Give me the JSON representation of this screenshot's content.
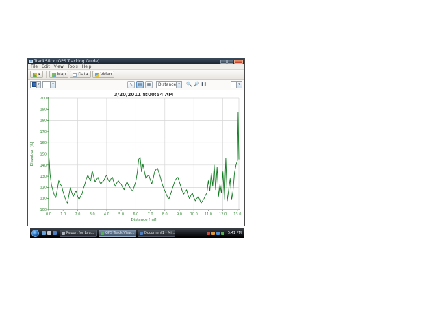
{
  "colors": {
    "line_green": "#0e7a1e",
    "spike_green": "#3f9e4f",
    "grid_gray": "#d6d6d6",
    "axis_green": "#2e7d32",
    "tick_text_green": "#3a8a3a",
    "title_text": "#333333"
  },
  "window": {
    "title": "TrackStick (GPS Tracking Guide)",
    "minimize_label": "minimize",
    "maximize_label": "maximize",
    "close_label": "close"
  },
  "menu": {
    "items": [
      "File",
      "Edit",
      "View",
      "Tools",
      "Help"
    ]
  },
  "toolbar": {
    "buttons": [
      {
        "label": "Map"
      },
      {
        "label": "Data"
      },
      {
        "label": "Video"
      }
    ]
  },
  "chart_toolbar": {
    "mode_dropdown_value": "Distance",
    "zoom_in_glyph": "🔍",
    "zoom_out_glyph": "🔎",
    "pause_glyph": "❚❚"
  },
  "chart_data": {
    "type": "line",
    "title": "3/20/2011 8:00:54 AM",
    "xlabel": "Distance [mi]",
    "ylabel": "Elevation [ft]",
    "xlim": [
      0,
      13.1
    ],
    "ylim": [
      100,
      200
    ],
    "xticks": [
      "0.0",
      "1.0",
      "2.0",
      "3.0",
      "4.0",
      "5.0",
      "6.0",
      "7.0",
      "8.0",
      "9.0",
      "10.0",
      "11.0",
      "12.0",
      "13.0"
    ],
    "yticks": [
      100,
      110,
      120,
      130,
      140,
      150,
      160,
      170,
      180,
      190,
      200
    ],
    "grid": true,
    "series": [
      {
        "name": "Elevation",
        "points": [
          [
            0.0,
            151
          ],
          [
            0.05,
            143
          ],
          [
            0.1,
            132
          ],
          [
            0.2,
            122
          ],
          [
            0.3,
            117
          ],
          [
            0.4,
            113
          ],
          [
            0.5,
            111
          ],
          [
            0.6,
            118
          ],
          [
            0.7,
            126
          ],
          [
            0.8,
            123
          ],
          [
            0.9,
            121
          ],
          [
            1.0,
            116
          ],
          [
            1.1,
            112
          ],
          [
            1.2,
            108
          ],
          [
            1.3,
            106
          ],
          [
            1.4,
            113
          ],
          [
            1.5,
            120
          ],
          [
            1.6,
            115
          ],
          [
            1.7,
            112
          ],
          [
            1.8,
            115
          ],
          [
            1.9,
            117
          ],
          [
            2.0,
            112
          ],
          [
            2.1,
            109
          ],
          [
            2.2,
            112
          ],
          [
            2.3,
            114
          ],
          [
            2.4,
            119
          ],
          [
            2.5,
            123
          ],
          [
            2.6,
            128
          ],
          [
            2.7,
            131
          ],
          [
            2.8,
            128
          ],
          [
            2.9,
            126
          ],
          [
            3.0,
            135
          ],
          [
            3.1,
            130
          ],
          [
            3.2,
            125
          ],
          [
            3.3,
            127
          ],
          [
            3.4,
            129
          ],
          [
            3.5,
            125
          ],
          [
            3.6,
            123
          ],
          [
            3.7,
            125
          ],
          [
            3.8,
            126
          ],
          [
            3.9,
            129
          ],
          [
            4.0,
            131
          ],
          [
            4.1,
            127
          ],
          [
            4.2,
            125
          ],
          [
            4.3,
            128
          ],
          [
            4.4,
            129
          ],
          [
            4.5,
            124
          ],
          [
            4.6,
            121
          ],
          [
            4.7,
            124
          ],
          [
            4.8,
            126
          ],
          [
            4.9,
            124
          ],
          [
            5.0,
            123
          ],
          [
            5.1,
            120
          ],
          [
            5.2,
            118
          ],
          [
            5.3,
            122
          ],
          [
            5.4,
            125
          ],
          [
            5.5,
            122
          ],
          [
            5.6,
            120
          ],
          [
            5.7,
            118
          ],
          [
            5.8,
            117
          ],
          [
            5.9,
            121
          ],
          [
            6.0,
            125
          ],
          [
            6.1,
            133
          ],
          [
            6.2,
            145
          ],
          [
            6.3,
            147
          ],
          [
            6.4,
            134
          ],
          [
            6.5,
            141
          ],
          [
            6.6,
            134
          ],
          [
            6.7,
            128
          ],
          [
            6.8,
            130
          ],
          [
            6.9,
            131
          ],
          [
            7.0,
            127
          ],
          [
            7.1,
            123
          ],
          [
            7.2,
            128
          ],
          [
            7.3,
            134
          ],
          [
            7.4,
            136
          ],
          [
            7.5,
            137
          ],
          [
            7.6,
            133
          ],
          [
            7.7,
            129
          ],
          [
            7.8,
            124
          ],
          [
            7.9,
            120
          ],
          [
            8.0,
            117
          ],
          [
            8.1,
            114
          ],
          [
            8.2,
            111
          ],
          [
            8.3,
            110
          ],
          [
            8.4,
            114
          ],
          [
            8.5,
            118
          ],
          [
            8.6,
            122
          ],
          [
            8.7,
            126
          ],
          [
            8.8,
            128
          ],
          [
            8.9,
            129
          ],
          [
            9.0,
            125
          ],
          [
            9.1,
            121
          ],
          [
            9.2,
            117
          ],
          [
            9.3,
            114
          ],
          [
            9.4,
            116
          ],
          [
            9.5,
            118
          ],
          [
            9.6,
            113
          ],
          [
            9.7,
            110
          ],
          [
            9.8,
            113
          ],
          [
            9.9,
            115
          ],
          [
            10.0,
            111
          ],
          [
            10.1,
            108
          ],
          [
            10.2,
            110
          ],
          [
            10.3,
            112
          ],
          [
            10.4,
            109
          ],
          [
            10.5,
            106
          ],
          [
            10.6,
            108
          ],
          [
            10.7,
            110
          ],
          [
            10.8,
            113
          ],
          [
            10.9,
            115
          ],
          [
            11.0,
            126
          ],
          [
            11.1,
            117
          ],
          [
            11.2,
            133
          ],
          [
            11.3,
            121
          ],
          [
            11.4,
            140
          ],
          [
            11.5,
            118
          ],
          [
            11.6,
            138
          ],
          [
            11.7,
            112
          ],
          [
            11.8,
            123
          ],
          [
            11.9,
            115
          ],
          [
            12.0,
            134
          ],
          [
            12.1,
            109
          ],
          [
            12.2,
            146
          ],
          [
            12.3,
            108
          ],
          [
            12.4,
            118
          ],
          [
            12.5,
            128
          ],
          [
            12.6,
            109
          ],
          [
            12.7,
            117
          ],
          [
            12.8,
            133
          ],
          [
            12.9,
            140
          ],
          [
            13.0,
            144
          ],
          [
            13.05,
            187
          ],
          [
            13.1,
            145
          ]
        ]
      }
    ],
    "legend": null
  },
  "taskbar": {
    "tasks": [
      {
        "label": "Report for Lau..."
      },
      {
        "label": "GPS Track View...",
        "active": true
      },
      {
        "label": "Document1 - Mi..."
      }
    ],
    "clock": "5:41 PM"
  }
}
